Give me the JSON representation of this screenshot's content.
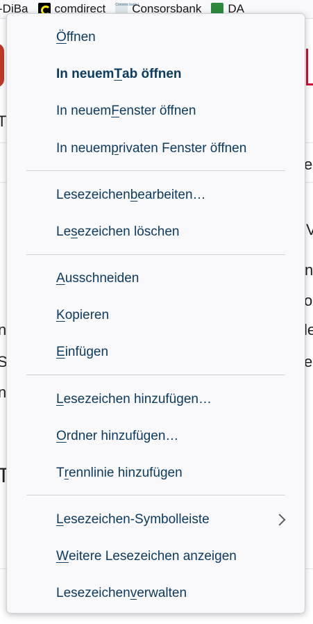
{
  "bookmarks_bar": {
    "items": [
      {
        "label": "-DiBa",
        "icon": "ing-diba-icon"
      },
      {
        "label": "comdirect",
        "icon": "comdirect-icon"
      },
      {
        "label": "Consorsbank",
        "icon": "consorsbank-icon"
      },
      {
        "label": "DA",
        "icon": "dab-icon"
      }
    ],
    "consors_favicon_text": "Consors bank !"
  },
  "background_fragments": {
    "t1": "T",
    "ez": "ez",
    "v": "V",
    "nt": "nt",
    "os": "os",
    "n": "n",
    "le": "le",
    "s": "S",
    "e": "e",
    "n2": "n",
    "t2": "T"
  },
  "context_menu": {
    "items": [
      {
        "pre": "",
        "key": "Ö",
        "post": "ffnen"
      },
      {
        "pre": "In neuem ",
        "key": "T",
        "post": "ab öffnen"
      },
      {
        "pre": "In neuem ",
        "key": "F",
        "post": "enster öffnen"
      },
      {
        "pre": "In neuem ",
        "key": "p",
        "post": "rivaten Fenster öffnen"
      },
      {
        "pre": "Lesezeichen ",
        "key": "b",
        "post": "earbeiten…"
      },
      {
        "pre": "Le",
        "key": "s",
        "post": "ezeichen löschen"
      },
      {
        "pre": "",
        "key": "A",
        "post": "usschneiden"
      },
      {
        "pre": "",
        "key": "K",
        "post": "opieren"
      },
      {
        "pre": "",
        "key": "E",
        "post": "infügen"
      },
      {
        "pre": "",
        "key": "L",
        "post": "esezeichen hinzufügen…"
      },
      {
        "pre": "",
        "key": "O",
        "post": "rdner hinzufügen…"
      },
      {
        "pre": "T",
        "key": "r",
        "post": "ennlinie hinzufügen"
      },
      {
        "pre": "",
        "key": "L",
        "post": "esezeichen-Symbolleiste"
      },
      {
        "pre": "",
        "key": "W",
        "post": "eitere Lesezeichen anzeigen"
      },
      {
        "pre": "Lesezeichen ",
        "key": "v",
        "post": "erwalten"
      }
    ]
  },
  "colors": {
    "menu_text": "#0b3b60",
    "menu_background": "#f9f9fb",
    "separator": "#cfcfd8"
  }
}
